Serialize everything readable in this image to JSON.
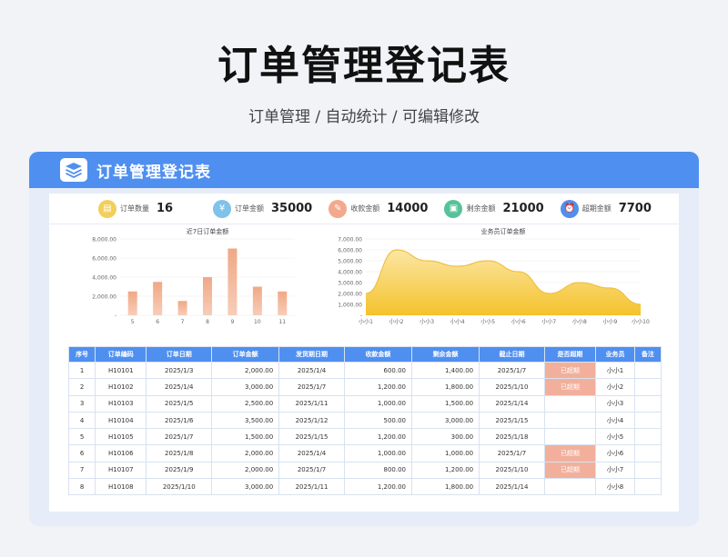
{
  "header": {
    "title": "订单管理登记表",
    "subtitle": "订单管理 / 自动统计 / 可编辑修改"
  },
  "card": {
    "title": "订单管理登记表"
  },
  "stats": [
    {
      "icon": "order-count-icon",
      "label": "订单数量",
      "value": "16",
      "color": "#f2cf5b"
    },
    {
      "icon": "order-amount-icon",
      "label": "订单金额",
      "value": "35000",
      "color": "#7fc2ea"
    },
    {
      "icon": "received-amount-icon",
      "label": "收款金额",
      "value": "14000",
      "color": "#f3a98e"
    },
    {
      "icon": "remaining-amount-icon",
      "label": "剩余金额",
      "value": "21000",
      "color": "#56c29a"
    },
    {
      "icon": "overdue-amount-icon",
      "label": "超期金额",
      "value": "7700",
      "color": "#4f8ff0"
    }
  ],
  "chart_data": [
    {
      "type": "bar",
      "title": "近7日订单金额",
      "categories": [
        "5",
        "6",
        "7",
        "8",
        "9",
        "10",
        "11"
      ],
      "values": [
        2500,
        3500,
        1500,
        4000,
        7000,
        3000,
        2500
      ],
      "ylim": [
        0,
        8000
      ],
      "yticks": [
        "-",
        "2,000.00",
        "4,000.00",
        "6,000.00",
        "8,000.00"
      ],
      "color": "#f0a886"
    },
    {
      "type": "area",
      "title": "业务员订单金额",
      "categories": [
        "小小1",
        "小小2",
        "小小3",
        "小小4",
        "小小5",
        "小小6",
        "小小7",
        "小小8",
        "小小9",
        "小小10"
      ],
      "values": [
        2000,
        6000,
        5000,
        4500,
        5000,
        4000,
        2000,
        3000,
        2500,
        1000
      ],
      "ylim": [
        0,
        7000
      ],
      "yticks": [
        "-",
        "1,000.00",
        "2,000.00",
        "3,000.00",
        "4,000.00",
        "5,000.00",
        "6,000.00",
        "7,000.00"
      ],
      "color": "#f5c842"
    }
  ],
  "table": {
    "columns": [
      "序号",
      "订单编码",
      "订单日期",
      "订单金额",
      "发货期日期",
      "收款金额",
      "剩余金额",
      "截止日期",
      "是否超期",
      "业务员",
      "备注"
    ],
    "rows": [
      [
        "1",
        "H10101",
        "2025/1/3",
        "2,000.00",
        "2025/1/4",
        "600.00",
        "1,400.00",
        "2025/1/7",
        "已超期",
        "小小1",
        ""
      ],
      [
        "2",
        "H10102",
        "2025/1/4",
        "3,000.00",
        "2025/1/7",
        "1,200.00",
        "1,800.00",
        "2025/1/10",
        "已超期",
        "小小2",
        ""
      ],
      [
        "3",
        "H10103",
        "2025/1/5",
        "2,500.00",
        "2025/1/11",
        "1,000.00",
        "1,500.00",
        "2025/1/14",
        "",
        "小小3",
        ""
      ],
      [
        "4",
        "H10104",
        "2025/1/6",
        "3,500.00",
        "2025/1/12",
        "500.00",
        "3,000.00",
        "2025/1/15",
        "",
        "小小4",
        ""
      ],
      [
        "5",
        "H10105",
        "2025/1/7",
        "1,500.00",
        "2025/1/15",
        "1,200.00",
        "300.00",
        "2025/1/18",
        "",
        "小小5",
        ""
      ],
      [
        "6",
        "H10106",
        "2025/1/8",
        "2,000.00",
        "2025/1/4",
        "1,000.00",
        "1,000.00",
        "2025/1/7",
        "已超期",
        "小小6",
        ""
      ],
      [
        "7",
        "H10107",
        "2025/1/9",
        "2,000.00",
        "2025/1/7",
        "800.00",
        "1,200.00",
        "2025/1/10",
        "已超期",
        "小小7",
        ""
      ],
      [
        "8",
        "H10108",
        "2025/1/10",
        "3,000.00",
        "2025/1/11",
        "1,200.00",
        "1,800.00",
        "2025/1/14",
        "",
        "小小8",
        ""
      ]
    ]
  }
}
